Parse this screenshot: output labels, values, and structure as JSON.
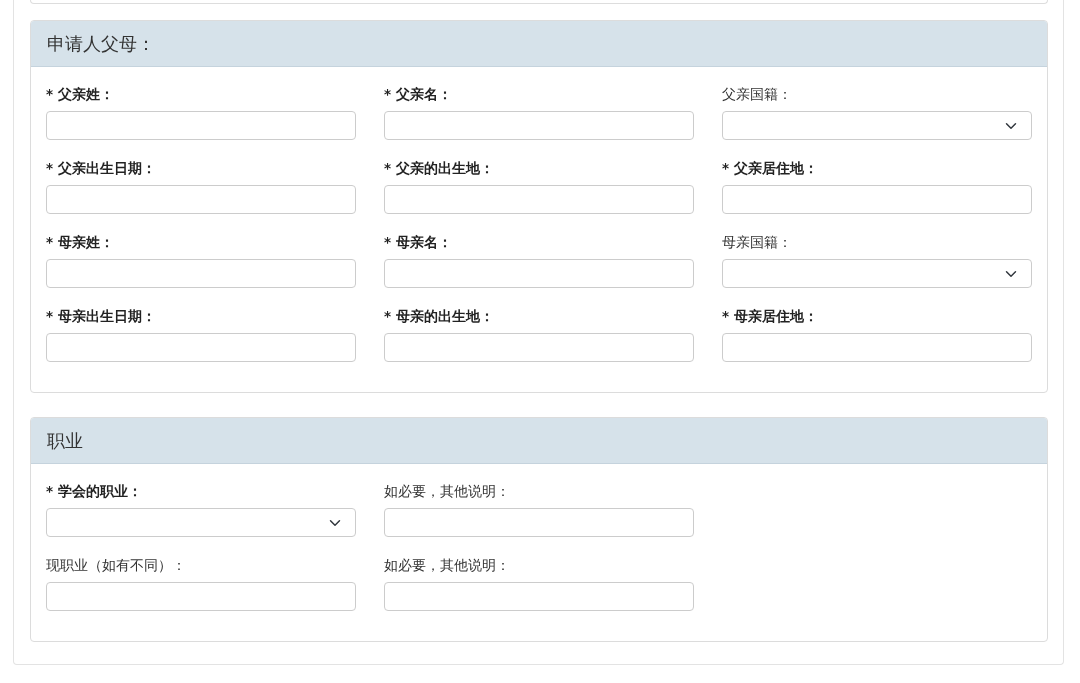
{
  "sections": [
    {
      "title": "申请人父母：",
      "rows": [
        [
          {
            "label": "* 父亲姓：",
            "required": true,
            "kind": "text"
          },
          {
            "label": "* 父亲名：",
            "required": true,
            "kind": "text"
          },
          {
            "label": "父亲国籍：",
            "required": false,
            "kind": "select"
          }
        ],
        [
          {
            "label": "* 父亲出生日期：",
            "required": true,
            "kind": "text"
          },
          {
            "label": "* 父亲的出生地：",
            "required": true,
            "kind": "text"
          },
          {
            "label": "* 父亲居住地：",
            "required": true,
            "kind": "text"
          }
        ],
        [
          {
            "label": "* 母亲姓：",
            "required": true,
            "kind": "text"
          },
          {
            "label": "* 母亲名：",
            "required": true,
            "kind": "text"
          },
          {
            "label": "母亲国籍：",
            "required": false,
            "kind": "select"
          }
        ],
        [
          {
            "label": "* 母亲出生日期：",
            "required": true,
            "kind": "text"
          },
          {
            "label": "* 母亲的出生地：",
            "required": true,
            "kind": "text"
          },
          {
            "label": "* 母亲居住地：",
            "required": true,
            "kind": "text"
          }
        ]
      ]
    },
    {
      "title": "职业",
      "rows": [
        [
          {
            "label": "* 学会的职业：",
            "required": true,
            "kind": "select"
          },
          {
            "label": "如必要，其他说明：",
            "required": false,
            "kind": "text"
          }
        ],
        [
          {
            "label": "现职业（如有不同）：",
            "required": false,
            "kind": "text"
          },
          {
            "label": "如必要，其他说明：",
            "required": false,
            "kind": "text"
          }
        ]
      ]
    }
  ]
}
